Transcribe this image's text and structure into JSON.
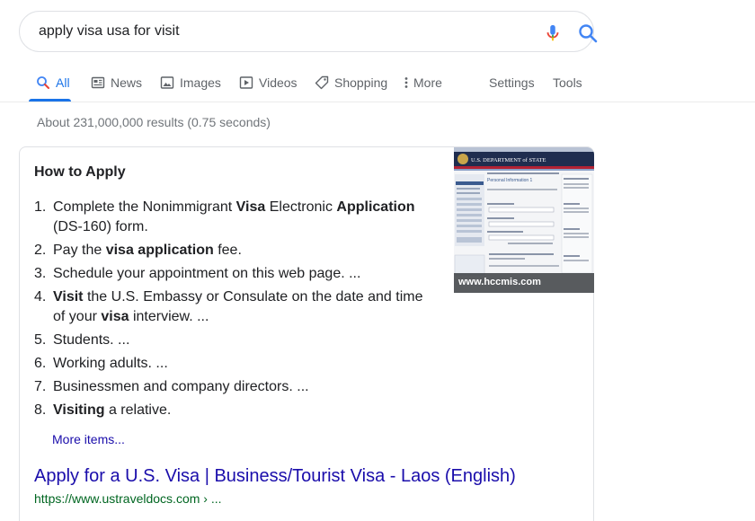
{
  "search": {
    "query": "apply visa usa for visit",
    "mic_icon": "microphone-icon",
    "search_icon": "magnifier-icon"
  },
  "tabs": [
    {
      "label": "All",
      "icon": "search-icon",
      "active": true
    },
    {
      "label": "News",
      "icon": "newspaper-icon"
    },
    {
      "label": "Images",
      "icon": "image-icon"
    },
    {
      "label": "Videos",
      "icon": "play-icon"
    },
    {
      "label": "Shopping",
      "icon": "tag-icon"
    },
    {
      "label": "More",
      "icon": "kebab-icon"
    },
    {
      "label": "Settings"
    },
    {
      "label": "Tools"
    }
  ],
  "stats": "About 231,000,000 results (0.75 seconds)",
  "snippet": {
    "title": "How to Apply",
    "steps": [
      {
        "num": "1.",
        "html": "Complete the Nonimmigrant <b>Visa</b> Electronic <b>Application</b> (DS-160) form."
      },
      {
        "num": "2.",
        "html": "Pay the <b>visa application</b> fee."
      },
      {
        "num": "3.",
        "html": "Schedule your appointment on this web page. ..."
      },
      {
        "num": "4.",
        "html": "<b>Visit</b> the U.S. Embassy or Consulate on the date and time of your <b>visa</b> interview. ..."
      },
      {
        "num": "5.",
        "html": "Students. ..."
      },
      {
        "num": "6.",
        "html": "Working adults. ..."
      },
      {
        "num": "7.",
        "html": "Businessmen and company directors. ..."
      },
      {
        "num": "8.",
        "html": "<b>Visiting</b> a relative."
      }
    ],
    "more_items": "More items...",
    "thumbnail": {
      "caption": "www.hccmis.com",
      "header_text": "U.S. DEPARTMENT of STATE",
      "form_title": "Personal Information 1"
    }
  },
  "result": {
    "title": "Apply for a U.S. Visa | Business/Tourist Visa - Laos (English)",
    "url": "https://www.ustraveldocs.com › ..."
  },
  "colors": {
    "link": "#1a0dab",
    "active_tab": "#1a73e8",
    "url_green": "#006621",
    "muted": "#70757a"
  }
}
